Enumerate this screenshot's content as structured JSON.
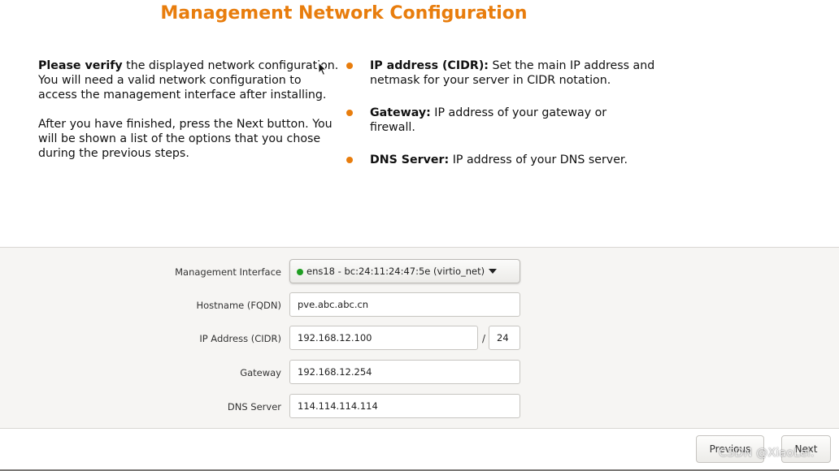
{
  "page": {
    "title": "Management Network Configuration"
  },
  "intro": {
    "p1_bold": "Please verify",
    "p1_rest": " the displayed network configuration. You will need a valid network configuration to access the management interface after installing.",
    "p2": "After you have finished, press the Next button. You will be shown a list of the options that you chose during the previous steps."
  },
  "bullets": [
    {
      "term": "IP address (CIDR):",
      "text": " Set the main IP address and netmask for your server in CIDR notation."
    },
    {
      "term": "Gateway:",
      "text": " IP address of your gateway or firewall."
    },
    {
      "term": "DNS Server:",
      "text": " IP address of your DNS server."
    }
  ],
  "form": {
    "mgmt_interface_label": "Management Interface",
    "mgmt_interface_value": "ens18 - bc:24:11:24:47:5e (virtio_net)",
    "hostname_label": "Hostname (FQDN)",
    "hostname_value": "pve.abc.abc.cn",
    "ip_label": "IP Address (CIDR)",
    "ip_value": "192.168.12.100",
    "cidr_separator": "/",
    "cidr_value": "24",
    "gateway_label": "Gateway",
    "gateway_value": "192.168.12.254",
    "dns_label": "DNS Server",
    "dns_value": "114.114.114.114"
  },
  "buttons": {
    "previous": "Previous",
    "next": "Next"
  },
  "watermark": "CSDN @XiaoLei.",
  "colors": {
    "accent": "#e87d0d",
    "status_green": "#1f9e22"
  }
}
